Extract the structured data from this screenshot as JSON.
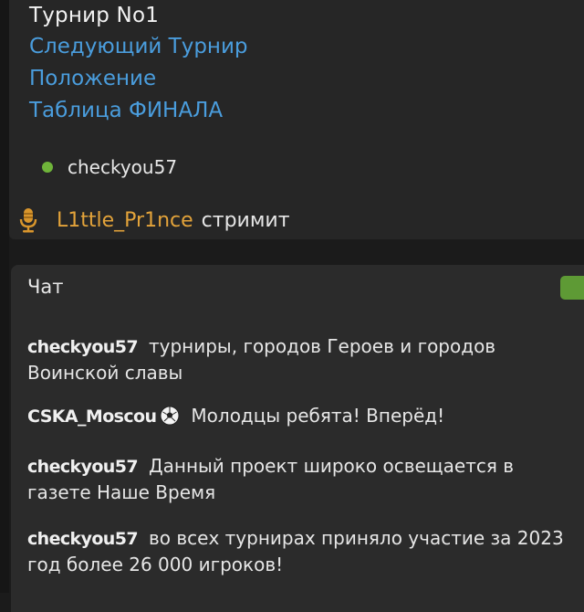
{
  "tournament": {
    "title": "Турнир No1",
    "links": [
      "Следующий Турнир",
      "Положение",
      "Таблица ФИНАЛА"
    ]
  },
  "online_users": [
    {
      "name": "checkyou57",
      "status_color": "#6fb43a"
    }
  ],
  "stream": {
    "icon": "microphone-icon",
    "streamer": "L1ttle_Pr1nce",
    "label": "стримит"
  },
  "chat": {
    "header": "Чат",
    "toggle_color": "#5e9a35",
    "messages": [
      {
        "author": "checkyou57",
        "text": "турниры, городов Героев и городов Воинской славы"
      },
      {
        "author": "CSKA_Moscou",
        "badge": "soccer-ball-icon",
        "text": "Молодцы ребята! Вперёд!"
      },
      {
        "author": "checkyou57",
        "text": "Данный проект широко освещается в газете Наше Время"
      },
      {
        "author": "checkyou57",
        "text": "во всех турнирах приняло участие за 2023 год более 26 000 игроков!"
      }
    ]
  }
}
